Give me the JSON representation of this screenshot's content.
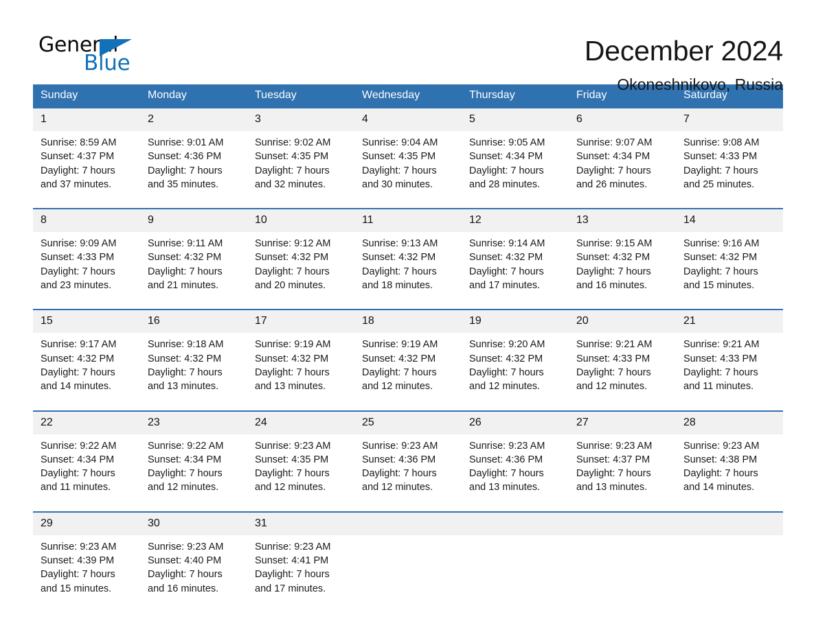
{
  "brand": {
    "name_top": "General",
    "name_bottom": "Blue",
    "accent_color": "#1271b8"
  },
  "header": {
    "month_title": "December 2024",
    "location": "Okoneshnikovo, Russia"
  },
  "theme": {
    "header_blue": "#3071b0",
    "daynum_band": "#f1f1f1",
    "text": "#1a1a1a"
  },
  "calendar": {
    "weekday_headers": [
      "Sunday",
      "Monday",
      "Tuesday",
      "Wednesday",
      "Thursday",
      "Friday",
      "Saturday"
    ],
    "weeks": [
      [
        {
          "day": "1",
          "sunrise": "Sunrise: 8:59 AM",
          "sunset": "Sunset: 4:37 PM",
          "daylight_1": "Daylight: 7 hours",
          "daylight_2": "and 37 minutes."
        },
        {
          "day": "2",
          "sunrise": "Sunrise: 9:01 AM",
          "sunset": "Sunset: 4:36 PM",
          "daylight_1": "Daylight: 7 hours",
          "daylight_2": "and 35 minutes."
        },
        {
          "day": "3",
          "sunrise": "Sunrise: 9:02 AM",
          "sunset": "Sunset: 4:35 PM",
          "daylight_1": "Daylight: 7 hours",
          "daylight_2": "and 32 minutes."
        },
        {
          "day": "4",
          "sunrise": "Sunrise: 9:04 AM",
          "sunset": "Sunset: 4:35 PM",
          "daylight_1": "Daylight: 7 hours",
          "daylight_2": "and 30 minutes."
        },
        {
          "day": "5",
          "sunrise": "Sunrise: 9:05 AM",
          "sunset": "Sunset: 4:34 PM",
          "daylight_1": "Daylight: 7 hours",
          "daylight_2": "and 28 minutes."
        },
        {
          "day": "6",
          "sunrise": "Sunrise: 9:07 AM",
          "sunset": "Sunset: 4:34 PM",
          "daylight_1": "Daylight: 7 hours",
          "daylight_2": "and 26 minutes."
        },
        {
          "day": "7",
          "sunrise": "Sunrise: 9:08 AM",
          "sunset": "Sunset: 4:33 PM",
          "daylight_1": "Daylight: 7 hours",
          "daylight_2": "and 25 minutes."
        }
      ],
      [
        {
          "day": "8",
          "sunrise": "Sunrise: 9:09 AM",
          "sunset": "Sunset: 4:33 PM",
          "daylight_1": "Daylight: 7 hours",
          "daylight_2": "and 23 minutes."
        },
        {
          "day": "9",
          "sunrise": "Sunrise: 9:11 AM",
          "sunset": "Sunset: 4:32 PM",
          "daylight_1": "Daylight: 7 hours",
          "daylight_2": "and 21 minutes."
        },
        {
          "day": "10",
          "sunrise": "Sunrise: 9:12 AM",
          "sunset": "Sunset: 4:32 PM",
          "daylight_1": "Daylight: 7 hours",
          "daylight_2": "and 20 minutes."
        },
        {
          "day": "11",
          "sunrise": "Sunrise: 9:13 AM",
          "sunset": "Sunset: 4:32 PM",
          "daylight_1": "Daylight: 7 hours",
          "daylight_2": "and 18 minutes."
        },
        {
          "day": "12",
          "sunrise": "Sunrise: 9:14 AM",
          "sunset": "Sunset: 4:32 PM",
          "daylight_1": "Daylight: 7 hours",
          "daylight_2": "and 17 minutes."
        },
        {
          "day": "13",
          "sunrise": "Sunrise: 9:15 AM",
          "sunset": "Sunset: 4:32 PM",
          "daylight_1": "Daylight: 7 hours",
          "daylight_2": "and 16 minutes."
        },
        {
          "day": "14",
          "sunrise": "Sunrise: 9:16 AM",
          "sunset": "Sunset: 4:32 PM",
          "daylight_1": "Daylight: 7 hours",
          "daylight_2": "and 15 minutes."
        }
      ],
      [
        {
          "day": "15",
          "sunrise": "Sunrise: 9:17 AM",
          "sunset": "Sunset: 4:32 PM",
          "daylight_1": "Daylight: 7 hours",
          "daylight_2": "and 14 minutes."
        },
        {
          "day": "16",
          "sunrise": "Sunrise: 9:18 AM",
          "sunset": "Sunset: 4:32 PM",
          "daylight_1": "Daylight: 7 hours",
          "daylight_2": "and 13 minutes."
        },
        {
          "day": "17",
          "sunrise": "Sunrise: 9:19 AM",
          "sunset": "Sunset: 4:32 PM",
          "daylight_1": "Daylight: 7 hours",
          "daylight_2": "and 13 minutes."
        },
        {
          "day": "18",
          "sunrise": "Sunrise: 9:19 AM",
          "sunset": "Sunset: 4:32 PM",
          "daylight_1": "Daylight: 7 hours",
          "daylight_2": "and 12 minutes."
        },
        {
          "day": "19",
          "sunrise": "Sunrise: 9:20 AM",
          "sunset": "Sunset: 4:32 PM",
          "daylight_1": "Daylight: 7 hours",
          "daylight_2": "and 12 minutes."
        },
        {
          "day": "20",
          "sunrise": "Sunrise: 9:21 AM",
          "sunset": "Sunset: 4:33 PM",
          "daylight_1": "Daylight: 7 hours",
          "daylight_2": "and 12 minutes."
        },
        {
          "day": "21",
          "sunrise": "Sunrise: 9:21 AM",
          "sunset": "Sunset: 4:33 PM",
          "daylight_1": "Daylight: 7 hours",
          "daylight_2": "and 11 minutes."
        }
      ],
      [
        {
          "day": "22",
          "sunrise": "Sunrise: 9:22 AM",
          "sunset": "Sunset: 4:34 PM",
          "daylight_1": "Daylight: 7 hours",
          "daylight_2": "and 11 minutes."
        },
        {
          "day": "23",
          "sunrise": "Sunrise: 9:22 AM",
          "sunset": "Sunset: 4:34 PM",
          "daylight_1": "Daylight: 7 hours",
          "daylight_2": "and 12 minutes."
        },
        {
          "day": "24",
          "sunrise": "Sunrise: 9:23 AM",
          "sunset": "Sunset: 4:35 PM",
          "daylight_1": "Daylight: 7 hours",
          "daylight_2": "and 12 minutes."
        },
        {
          "day": "25",
          "sunrise": "Sunrise: 9:23 AM",
          "sunset": "Sunset: 4:36 PM",
          "daylight_1": "Daylight: 7 hours",
          "daylight_2": "and 12 minutes."
        },
        {
          "day": "26",
          "sunrise": "Sunrise: 9:23 AM",
          "sunset": "Sunset: 4:36 PM",
          "daylight_1": "Daylight: 7 hours",
          "daylight_2": "and 13 minutes."
        },
        {
          "day": "27",
          "sunrise": "Sunrise: 9:23 AM",
          "sunset": "Sunset: 4:37 PM",
          "daylight_1": "Daylight: 7 hours",
          "daylight_2": "and 13 minutes."
        },
        {
          "day": "28",
          "sunrise": "Sunrise: 9:23 AM",
          "sunset": "Sunset: 4:38 PM",
          "daylight_1": "Daylight: 7 hours",
          "daylight_2": "and 14 minutes."
        }
      ],
      [
        {
          "day": "29",
          "sunrise": "Sunrise: 9:23 AM",
          "sunset": "Sunset: 4:39 PM",
          "daylight_1": "Daylight: 7 hours",
          "daylight_2": "and 15 minutes."
        },
        {
          "day": "30",
          "sunrise": "Sunrise: 9:23 AM",
          "sunset": "Sunset: 4:40 PM",
          "daylight_1": "Daylight: 7 hours",
          "daylight_2": "and 16 minutes."
        },
        {
          "day": "31",
          "sunrise": "Sunrise: 9:23 AM",
          "sunset": "Sunset: 4:41 PM",
          "daylight_1": "Daylight: 7 hours",
          "daylight_2": "and 17 minutes."
        },
        {
          "day": "",
          "sunrise": "",
          "sunset": "",
          "daylight_1": "",
          "daylight_2": ""
        },
        {
          "day": "",
          "sunrise": "",
          "sunset": "",
          "daylight_1": "",
          "daylight_2": ""
        },
        {
          "day": "",
          "sunrise": "",
          "sunset": "",
          "daylight_1": "",
          "daylight_2": ""
        },
        {
          "day": "",
          "sunrise": "",
          "sunset": "",
          "daylight_1": "",
          "daylight_2": ""
        }
      ]
    ]
  }
}
